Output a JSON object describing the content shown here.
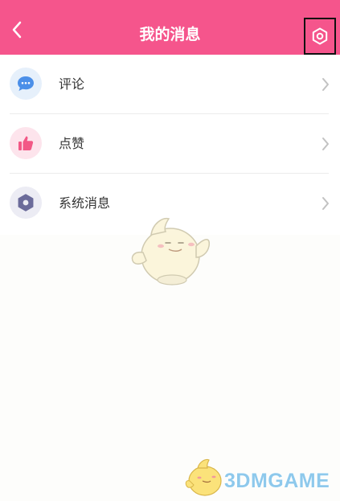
{
  "header": {
    "title": "我的消息",
    "back_icon": "chevron-left-icon",
    "settings_icon": "gear-icon",
    "background": "#f5558c"
  },
  "messages": [
    {
      "label": "评论",
      "icon": "comment-bubble-icon",
      "icon_bg": "#e6f0fb",
      "icon_color": "#4b8fe8"
    },
    {
      "label": "点赞",
      "icon": "thumbs-up-icon",
      "icon_bg": "#fde4ec",
      "icon_color": "#f25886"
    },
    {
      "label": "系统消息",
      "icon": "gear-icon",
      "icon_bg": "#ececf4",
      "icon_color": "#6b6b9a"
    }
  ],
  "watermark": {
    "text": "3DMGAME"
  }
}
